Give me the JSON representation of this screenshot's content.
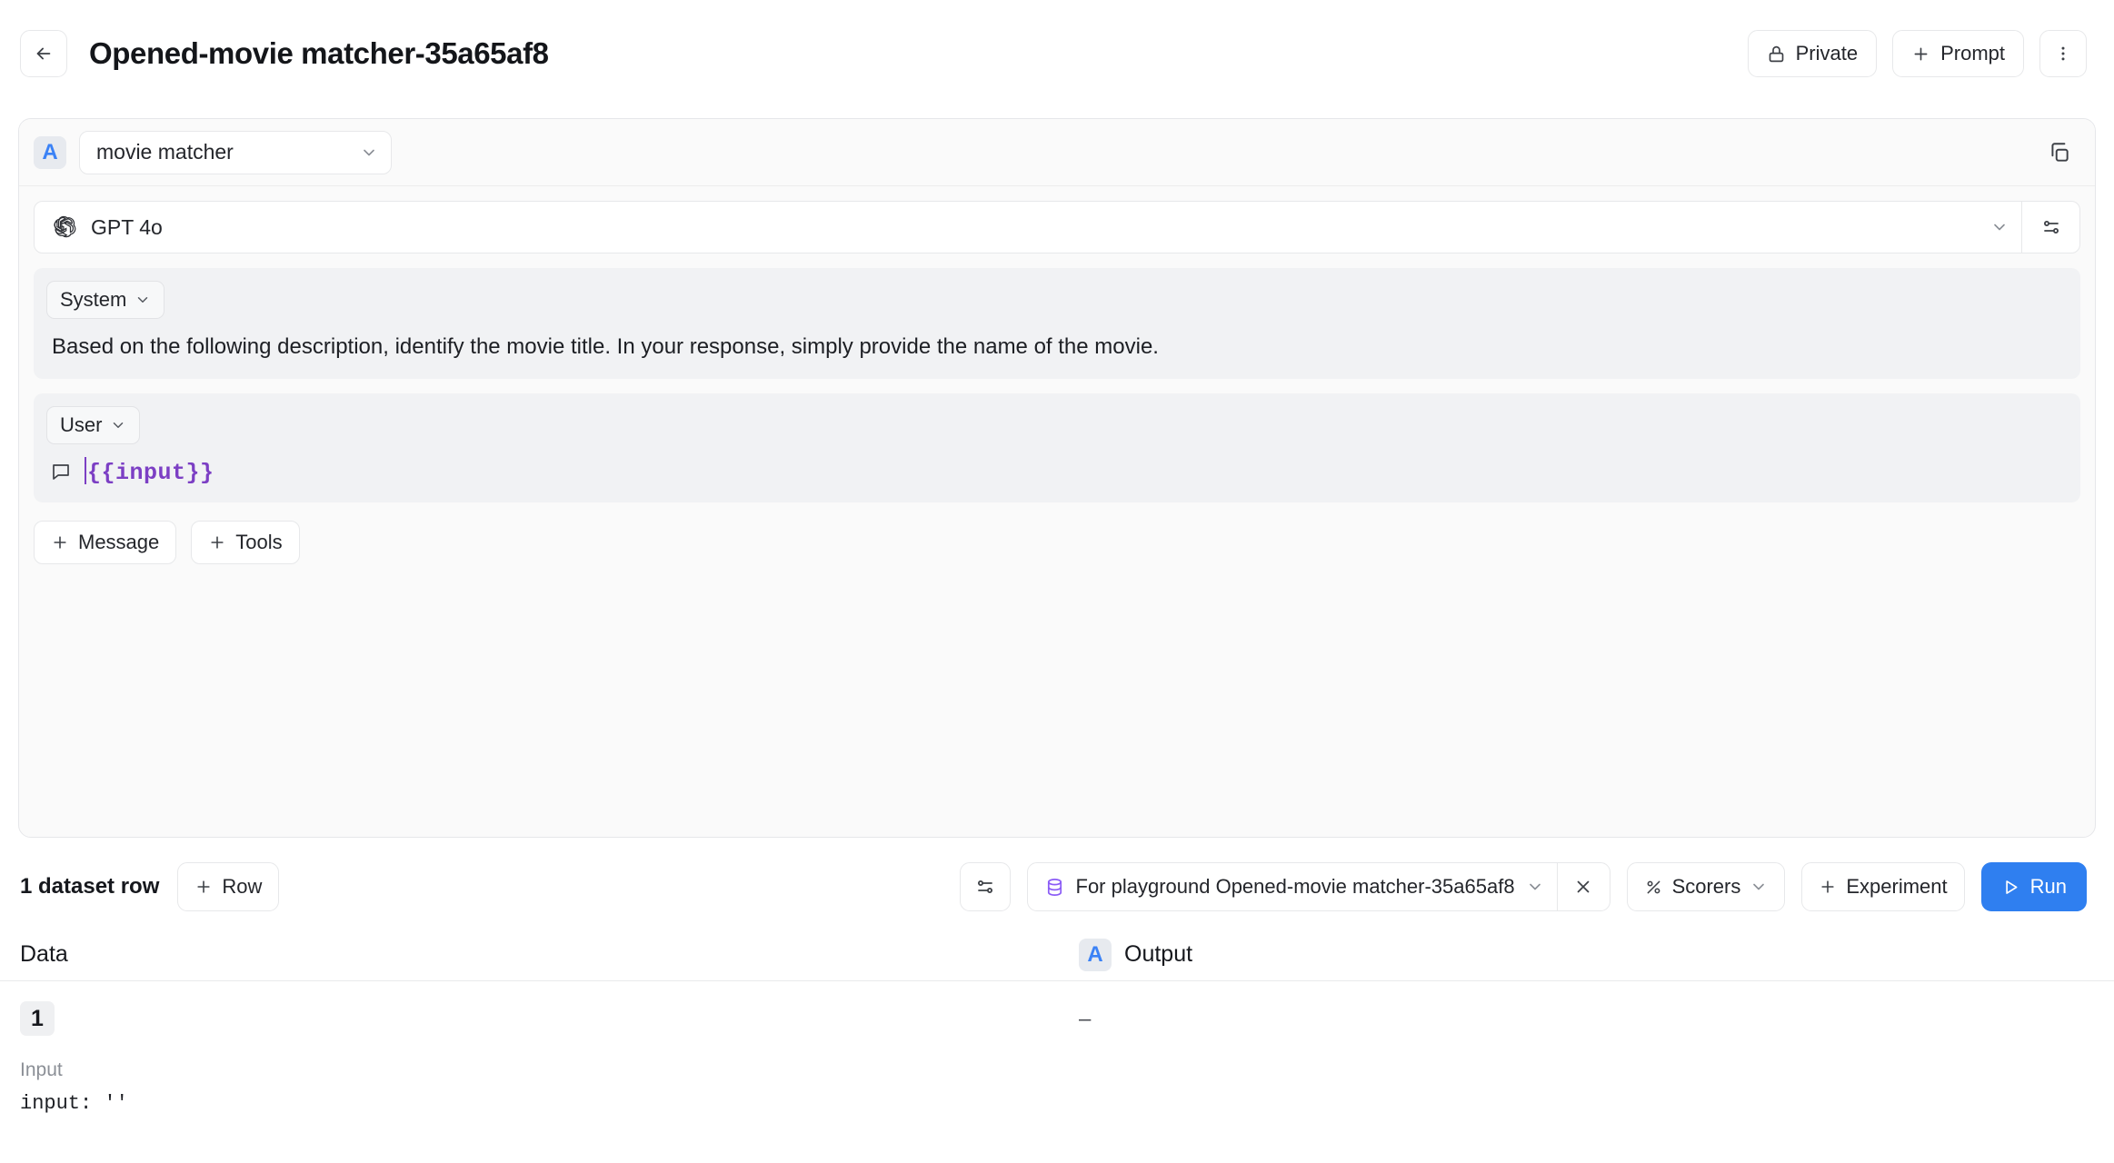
{
  "header": {
    "back_icon": "arrow-left-icon",
    "title": "Opened-movie matcher-35a65af8",
    "private_label": "Private",
    "private_icon": "lock-icon",
    "prompt_label": "Prompt",
    "prompt_icon": "plus-icon",
    "more_icon": "kebab-menu-icon"
  },
  "prompt_card": {
    "badge": "A",
    "name": "movie matcher",
    "name_caret_icon": "chevron-down-icon",
    "copy_icon": "copy-icon",
    "model": {
      "icon": "openai-logo-icon",
      "name": "GPT 4o",
      "caret_icon": "chevron-down-icon",
      "settings_icon": "sliders-icon"
    },
    "messages": [
      {
        "role": "System",
        "role_caret_icon": "chevron-down-icon",
        "text": "Based on the following description, identify the movie title. In your response, simply provide the name of the movie.",
        "kind": "text"
      },
      {
        "role": "User",
        "role_caret_icon": "chevron-down-icon",
        "text": "{{input}}",
        "kind": "variable",
        "leading_icon": "message-bubble-icon"
      }
    ],
    "add_message_label": "Message",
    "add_tools_label": "Tools",
    "add_icon": "plus-icon"
  },
  "dataset_bar": {
    "row_count_label": "1 dataset row",
    "add_row_label": "Row",
    "add_row_icon": "plus-icon",
    "filter_icon": "sliders-icon",
    "dataset_icon": "database-icon",
    "dataset_name": "For playground Opened-movie matcher-35a65af8",
    "dataset_caret_icon": "chevron-down-icon",
    "dataset_clear_icon": "close-x-icon",
    "scorers_label": "Scorers",
    "scorers_icon": "percent-icon",
    "scorers_caret_icon": "chevron-down-icon",
    "experiment_label": "Experiment",
    "experiment_icon": "plus-icon",
    "run_label": "Run",
    "run_icon": "play-icon"
  },
  "results_table": {
    "columns": {
      "data_label": "Data",
      "output_badge": "A",
      "output_label": "Output"
    },
    "rows": [
      {
        "index": "1",
        "input_label": "Input",
        "input_value": "input: ''",
        "output_value": "–"
      }
    ]
  },
  "colors": {
    "accent_blue": "#2f7ff0",
    "badge_blue": "#3b82f6",
    "variable_purple": "#7c3fc4",
    "database_purple": "#8b5cf6",
    "card_bg": "#fafafa",
    "message_bg": "#f1f2f4",
    "border": "#e7e8ea"
  }
}
